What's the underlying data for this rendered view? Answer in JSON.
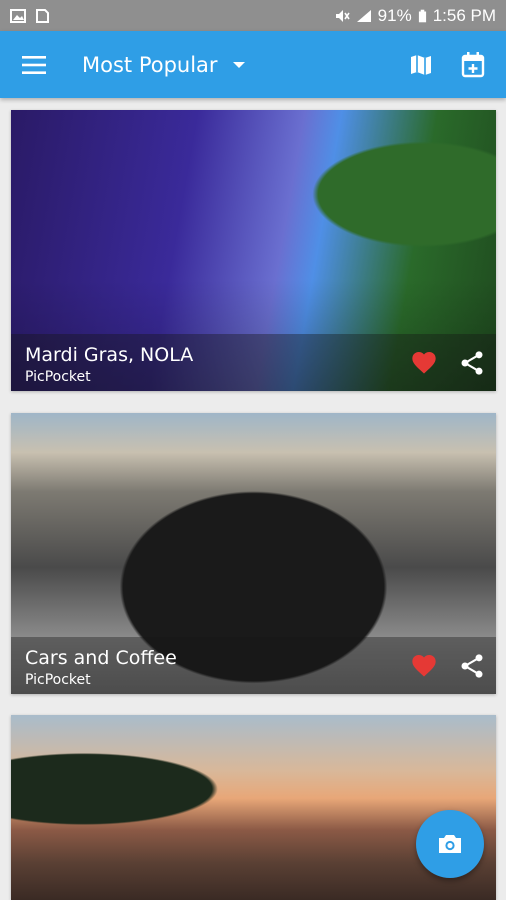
{
  "status_bar": {
    "battery": "91%",
    "time": "1:56 PM",
    "icons": [
      "image-icon",
      "sim-icon",
      "mute-icon",
      "signal-icon",
      "battery-icon"
    ]
  },
  "app_bar": {
    "title": "Most Popular",
    "icons": {
      "menu": "menu-icon",
      "dropdown": "dropdown-arrow-icon",
      "map": "map-icon",
      "calendar": "calendar-add-icon"
    }
  },
  "cards": [
    {
      "title": "Mardi Gras, NOLA",
      "source": "PicPocket",
      "image": "marching-band-photo",
      "favorited": true
    },
    {
      "title": "Cars and Coffee",
      "source": "PicPocket",
      "image": "classic-car-photo",
      "favorited": true
    },
    {
      "title": "",
      "source": "",
      "image": "canyon-sunset-photo"
    }
  ],
  "fab": {
    "icon": "camera-icon"
  },
  "colors": {
    "primary": "#2f9ee6",
    "heart": "#e53935",
    "status_bar": "#8f8f8f"
  }
}
